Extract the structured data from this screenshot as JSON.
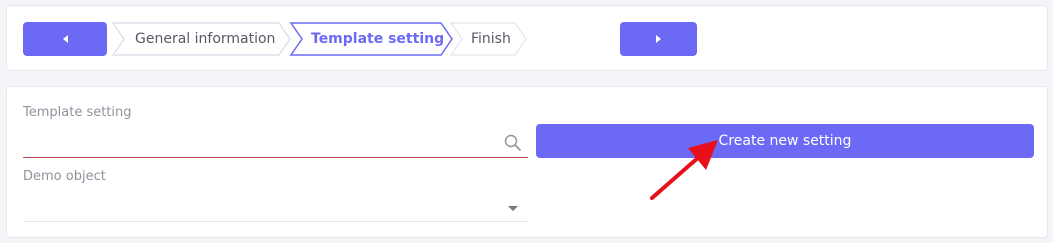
{
  "wizard": {
    "prev_icon": "chevron-left-icon",
    "next_icon": "chevron-right-icon",
    "steps": [
      {
        "label": "General information",
        "state": "done"
      },
      {
        "label": "Template setting",
        "state": "active"
      },
      {
        "label": "Finish",
        "state": "pending"
      }
    ]
  },
  "form": {
    "template_setting": {
      "label": "Template setting",
      "value": "",
      "placeholder": "",
      "icon": "search-icon"
    },
    "create_button_label": "Create new setting",
    "demo_object": {
      "label": "Demo object",
      "selected": "",
      "icon": "chevron-down-icon"
    }
  },
  "annotation": {
    "icon": "red-arrow-pointer",
    "color": "#e8101a"
  },
  "colors": {
    "accent": "#6c6af5",
    "input_underline_error": "#b9444a",
    "background": "#f4f5f8"
  }
}
